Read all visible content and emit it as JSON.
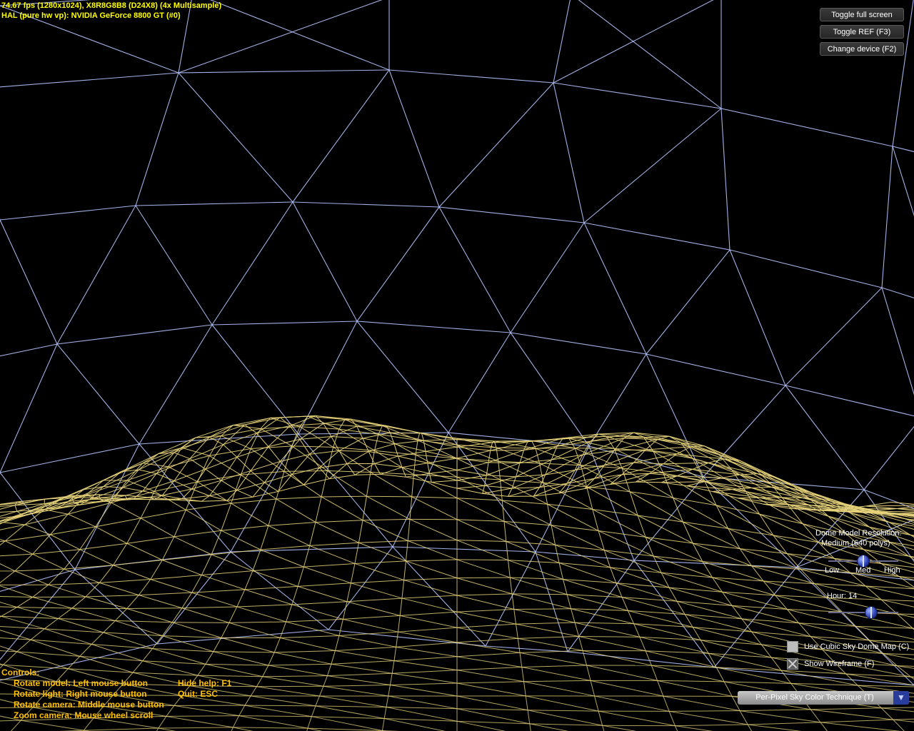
{
  "stats": {
    "fps_line": "74.67 fps (1280x1024), X8R8G8B8 (D24X8) (4x Multisample)",
    "device_line": "HAL (pure hw vp): NVIDIA GeForce 8800 GT (#0)"
  },
  "buttons": {
    "toggle_full_screen": "Toggle full screen",
    "toggle_ref": "Toggle REF (F3)",
    "change_device": "Change device (F2)"
  },
  "dome_resolution": {
    "title": "Dome Model Resolution:",
    "value_text": "Medium (640 polys)",
    "ticks": [
      "Low",
      "Med",
      "High"
    ],
    "level": 0.5
  },
  "hour": {
    "label": "Hour: 14",
    "value": 14,
    "min": 0,
    "max": 23
  },
  "checkboxes": {
    "cubic_sky": {
      "label": "Use Cubic Sky Dome Map (C)",
      "checked": false
    },
    "wireframe": {
      "label": "Show Wireframe (F)",
      "checked": true
    }
  },
  "technique": {
    "selected": "Per-Pixel Sky Color Technique (T)",
    "arrow_icon": "chevron-down-icon"
  },
  "help": {
    "title": "Controls:",
    "lines": [
      "Rotate model: Left mouse button",
      "Rotate light: Right mouse button",
      "Rotate camera: Middle mouse button",
      "Zoom camera: Mouse wheel scroll"
    ],
    "hide_help": "Hide help: F1",
    "quit": "Quit: ESC"
  },
  "colors": {
    "background": "#000000",
    "sky_wire": "#b4c4ff",
    "terrain_wire": "#e6d27a",
    "stats_text": "#ffff00",
    "help_text": "#ffc000"
  }
}
